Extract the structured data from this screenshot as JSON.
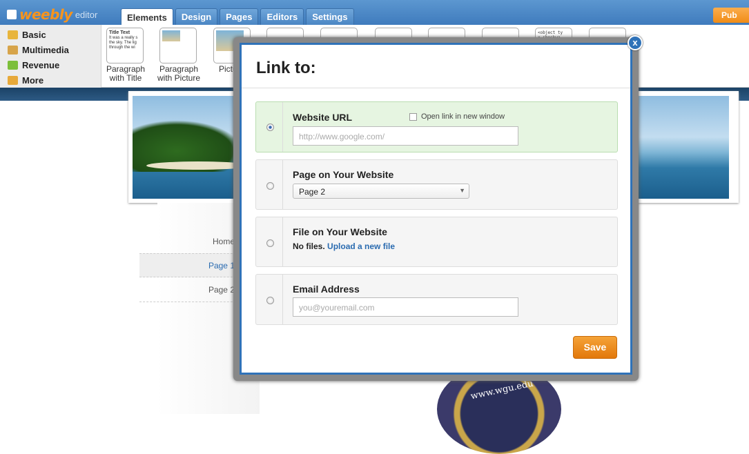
{
  "app": {
    "logo_text": "weebly",
    "logo_suffix": "editor",
    "publish_label": "Pub"
  },
  "tabs": [
    {
      "label": "Elements",
      "active": true
    },
    {
      "label": "Design"
    },
    {
      "label": "Pages"
    },
    {
      "label": "Editors"
    },
    {
      "label": "Settings"
    }
  ],
  "categories": [
    {
      "label": "Basic",
      "color": "#e8b53c"
    },
    {
      "label": "Multimedia",
      "color": "#d7a44a"
    },
    {
      "label": "Revenue",
      "color": "#7cbf3a"
    },
    {
      "label": "More",
      "color": "#e7a93a"
    }
  ],
  "elements": {
    "para_title": {
      "label1": "Paragraph",
      "label2": "with Title",
      "thumb_title": "Title Text",
      "thumb_body": "It was a really s the sky. The lig through the wi"
    },
    "para_picture": {
      "label1": "Paragraph",
      "label2": "with Picture"
    },
    "picture": {
      "label1": "Pictu"
    },
    "code_thumb": "<object ty x-shockwa"
  },
  "site_nav": [
    {
      "label": "Home"
    },
    {
      "label": "Page 1",
      "active": true
    },
    {
      "label": "Page 2"
    }
  ],
  "seal_text": "www.wgu.edu",
  "modal": {
    "title": "Link to:",
    "close_label": "x",
    "website_url": {
      "label": "Website URL",
      "placeholder": "http://www.google.com/",
      "selected": true,
      "new_window_label": "Open link in new window"
    },
    "page": {
      "label": "Page on Your Website",
      "selected_value": "Page 2"
    },
    "file": {
      "label": "File on Your Website",
      "no_files": "No files.",
      "upload_link": "Upload a new file"
    },
    "email": {
      "label": "Email Address",
      "placeholder": "you@youremail.com"
    },
    "save_label": "Save"
  }
}
